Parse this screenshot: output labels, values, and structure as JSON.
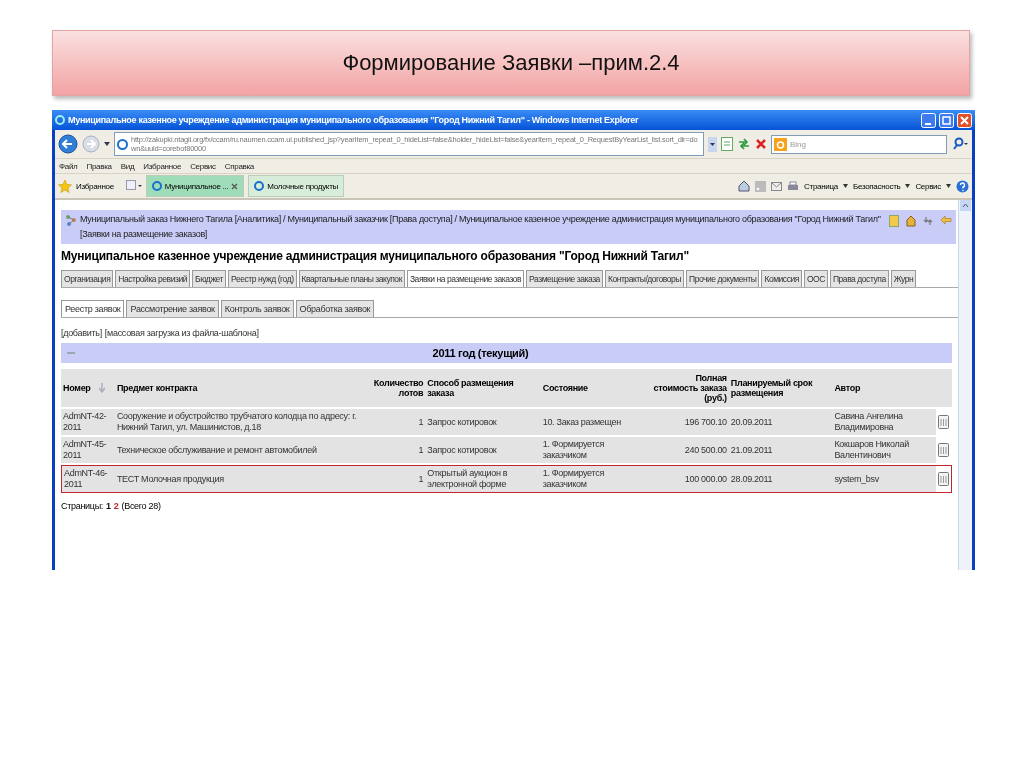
{
  "slide_title": "Формирование Заявки –прим.2.4",
  "browser": {
    "title": "Муниципальное казенное учреждение администрация муниципального образования \"Город Нижний Тагил\" - Windows Internet Explorer",
    "address": "http://zakupki.ntagil.org/fx/ccam/ru.naumen.ccam.ui.published_jsp?yearItem_repeat_0_hideList=false&holder_hideList=false&yearItem_repeat_0_RequestByYearList_list.sort_dir=down&uuid=corebof80000",
    "search": {
      "placeholder": "Bing"
    },
    "menu": [
      "Файл",
      "Правка",
      "Вид",
      "Избранное",
      "Сервис",
      "Справка"
    ],
    "favorites_label": "Избранное",
    "tabs": [
      {
        "label": "Муниципальное ...",
        "selected": true
      },
      {
        "label": "Молочные продукты",
        "selected": false
      }
    ],
    "tools": [
      "Страница",
      "Безопасность",
      "Сервис"
    ]
  },
  "page": {
    "breadcrumb": "Муниципальный заказ Нижнего Тагила [Аналитика] / Муниципальный заказчик [Права доступа] / Муниципальное казенное учреждение администрация муниципального образования \"Город Нижний Тагил\" [Заявки на размещение заказов]",
    "org_title": "Муниципальное казенное учреждение администрация муниципального образования \"Город Нижний Тагил\"",
    "tabs": [
      {
        "label": "Организация",
        "selected": false
      },
      {
        "label": "Настройка ревизий",
        "selected": false
      },
      {
        "label": "Бюджет",
        "selected": false
      },
      {
        "label": "Реестр нужд (год)",
        "selected": false
      },
      {
        "label": "Квартальные планы закупок",
        "selected": false
      },
      {
        "label": "Заявки на размещение заказов",
        "selected": true
      },
      {
        "label": "Размещение заказа",
        "selected": false
      },
      {
        "label": "Контракты/договоры",
        "selected": false
      },
      {
        "label": "Прочие документы",
        "selected": false
      },
      {
        "label": "Комиссия",
        "selected": false
      },
      {
        "label": "ООС",
        "selected": false
      },
      {
        "label": "Права доступа",
        "selected": false
      },
      {
        "label": "Журн",
        "selected": false
      }
    ],
    "subtabs": [
      {
        "label": "Реестр заявок",
        "selected": true
      },
      {
        "label": "Рассмотрение заявок",
        "selected": false
      },
      {
        "label": "Контроль заявок",
        "selected": false
      },
      {
        "label": "Обработка заявок",
        "selected": false
      }
    ],
    "actions": [
      "[добавить]",
      "[массовая загрузка из файла-шаблона]"
    ],
    "group_title": "2011 год (текущий)",
    "table": {
      "columns": [
        "Номер",
        "Предмет контракта",
        "Количество лотов",
        "Способ размещения заказа",
        "Состояние",
        "Полная стоимость заказа (руб.)",
        "Планируемый срок размещения",
        "Автор"
      ],
      "rows": [
        {
          "cells": [
            "AdmNT-42-2011",
            "Сооружение и обустройство трубчатого колодца по адресу: г. Нижний Тагил, ул. Машинистов, д.18",
            "1",
            "Запрос котировок",
            "10. Заказ размещен",
            "196 700.10",
            "20.09.2011",
            "Савина Ангелина Владимировна"
          ],
          "highlighted": false
        },
        {
          "cells": [
            "AdmNT-45-2011",
            "Техническое обслуживание и ремонт автомобилей",
            "1",
            "Запрос котировок",
            "1. Формируется заказчиком",
            "240 500.00",
            "21.09.2011",
            "Кокшаров Николай Валентинович"
          ],
          "highlighted": false
        },
        {
          "cells": [
            "AdmNT-46-2011",
            "ТЕСТ Молочная продукция",
            "1",
            "Открытый аукцион в электронной форме",
            "1. Формируется заказчиком",
            "100 000.00",
            "28.09.2011",
            "system_bsv"
          ],
          "highlighted": true
        }
      ]
    },
    "pager": {
      "label": "Страницы:",
      "pages": [
        {
          "label": "1",
          "selected": false
        },
        {
          "label": "2",
          "selected": true
        }
      ],
      "total": "(Всего 28)"
    }
  }
}
